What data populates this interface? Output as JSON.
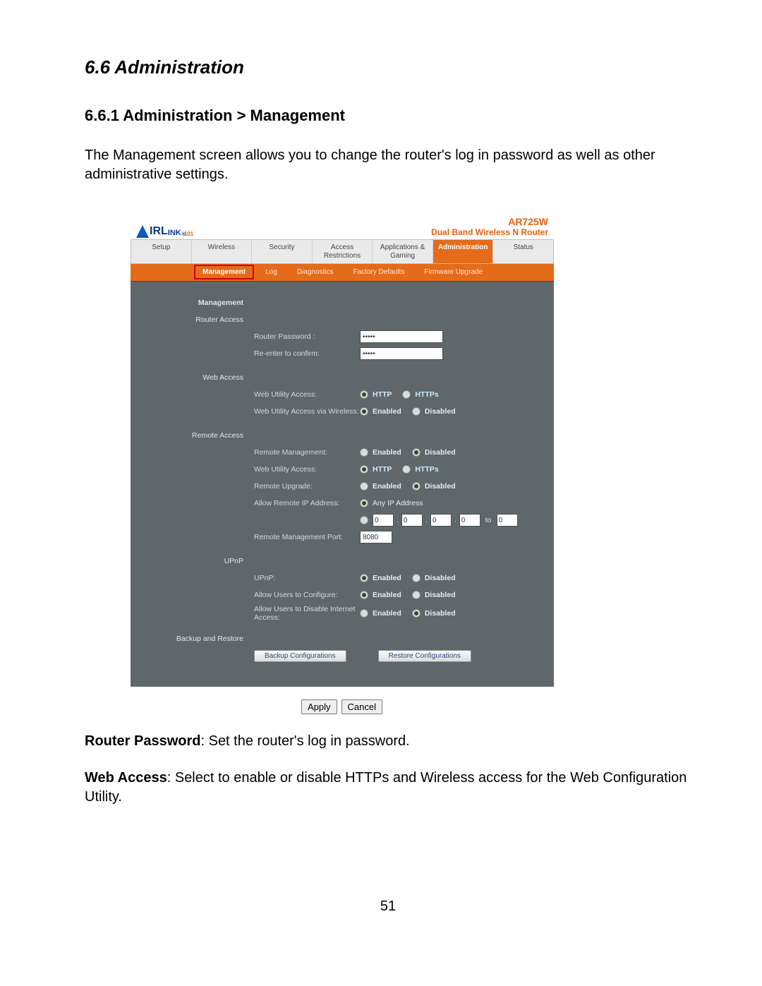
{
  "doc": {
    "heading": "6.6 Administration",
    "subheading": "6.6.1 Administration > Management",
    "intro": "The Management screen allows you to change the router's log in password as well as other administrative settings.",
    "desc_router_password_label": "Router Password",
    "desc_router_password_text": ": Set the router's log in password.",
    "desc_web_access_label": "Web Access",
    "desc_web_access_text": ": Select to enable or disable HTTPs and Wireless access for the Web Configuration Utility.",
    "page_number": "51"
  },
  "router": {
    "logo_prefix": "IRL",
    "logo_mid": "INK",
    "logo_101": "101",
    "model": "AR725W",
    "tagline": "Dual Band Wireless N Router",
    "main_tabs": [
      "Setup",
      "Wireless",
      "Security",
      "Access Restrictions",
      "Applications & Gaming",
      "Administration",
      "Status"
    ],
    "sub_tabs": [
      "Management",
      "Log",
      "Diagnostics",
      "Factory Defaults",
      "Firmware Upgrade"
    ],
    "sections": {
      "management": "Management",
      "router_access": "Router Access",
      "web_access": "Web Access",
      "remote_access": "Remote Access",
      "upnp": "UPnP",
      "backup": "Backup and Restore"
    },
    "labels": {
      "router_password": "Router Password :",
      "reenter": "Re-enter to confirm:",
      "web_utility_access": "Web Utility Access:",
      "web_utility_via_wireless": "Web Utility Access via Wireless:",
      "remote_management": "Remote Management:",
      "remote_web_utility": "Web Utility Access:",
      "remote_upgrade": "Remote Upgrade:",
      "allow_remote_ip": "Allow Remote IP Address:",
      "remote_mgmt_port": "Remote Management Port:",
      "upnp": "UPnP:",
      "allow_users_configure": "Allow Users to Configure:",
      "allow_users_disable_internet": "Allow Users to Disable Internet Access:"
    },
    "values": {
      "pwd": "•••••",
      "confirm": "•••••",
      "http": "HTTP",
      "https": "HTTPs",
      "enabled": "Enabled",
      "disabled": "Disabled",
      "any_ip": "Any IP Address",
      "ip_oct": "0",
      "ip_to": "to",
      "port": "8080"
    },
    "buttons": {
      "backup": "Backup Configurations",
      "restore": "Restore Configurations",
      "apply": "Apply",
      "cancel": "Cancel"
    }
  }
}
